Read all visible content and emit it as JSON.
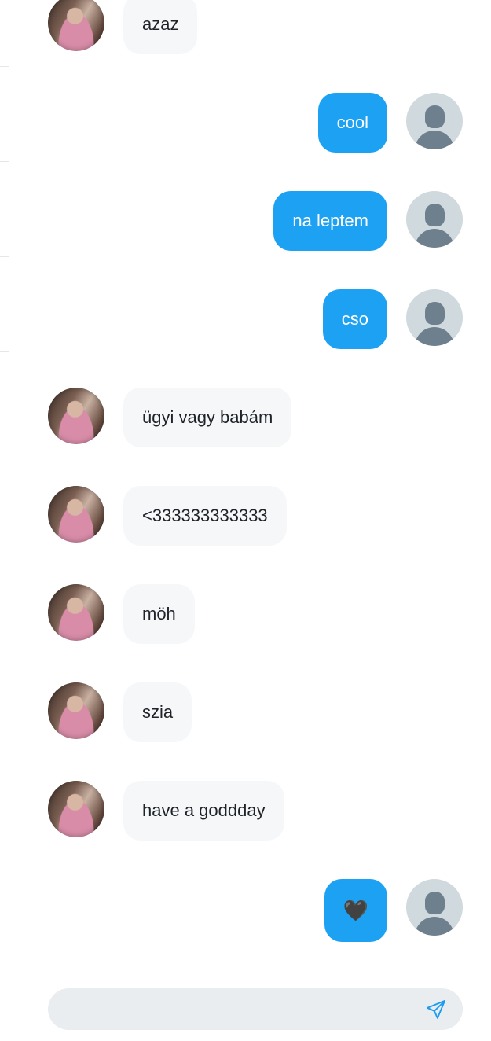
{
  "chat": {
    "messages": [
      {
        "direction": "in",
        "text": "azaz"
      },
      {
        "direction": "out",
        "text": "cool"
      },
      {
        "direction": "out",
        "text": "na leptem"
      },
      {
        "direction": "out",
        "text": "cso"
      },
      {
        "direction": "in",
        "text": "ügyi vagy babám"
      },
      {
        "direction": "in",
        "text": "<333333333333"
      },
      {
        "direction": "in",
        "text": "möh"
      },
      {
        "direction": "in",
        "text": "szia"
      },
      {
        "direction": "in",
        "text": "have a goddday"
      },
      {
        "direction": "out",
        "text": "🖤",
        "kind": "emoji",
        "icon": "black-heart-icon"
      }
    ]
  },
  "composer": {
    "value": "",
    "placeholder": "",
    "send_icon": "paper-plane-icon"
  },
  "colors": {
    "outgoing_bubble": "#1da1f2",
    "incoming_bubble": "#f5f7f9",
    "composer_bg": "#e9edf0",
    "send_icon": "#1d9bf0"
  }
}
